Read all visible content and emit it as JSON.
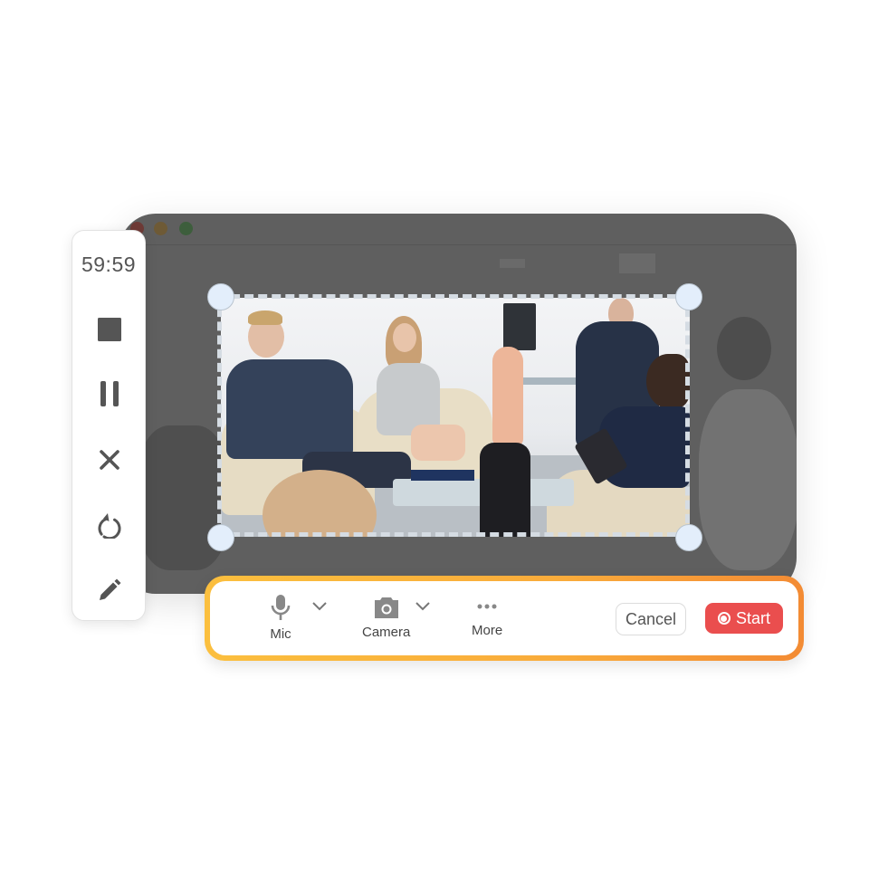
{
  "window": {
    "traffic_lights": [
      "close",
      "minimize",
      "maximize"
    ]
  },
  "recorder_sidebar": {
    "timer": "59:59",
    "buttons": [
      {
        "name": "stop",
        "icon": "stop-icon"
      },
      {
        "name": "pause",
        "icon": "pause-icon"
      },
      {
        "name": "cancel",
        "icon": "close-icon"
      },
      {
        "name": "restart",
        "icon": "restart-icon"
      },
      {
        "name": "annotate",
        "icon": "pencil-icon"
      }
    ]
  },
  "capture_region": {
    "description": "Office meeting photo inside dashed selection frame"
  },
  "control_bar": {
    "mic": {
      "label": "Mic",
      "icon": "microphone-icon"
    },
    "camera": {
      "label": "Camera",
      "icon": "camera-icon"
    },
    "more": {
      "label": "More",
      "icon": "more-dots-icon"
    },
    "cancel_label": "Cancel",
    "start_label": "Start",
    "colors": {
      "start": "#ea4e4e",
      "border_start": "#fbbf3e",
      "border_end": "#f38b34"
    }
  }
}
